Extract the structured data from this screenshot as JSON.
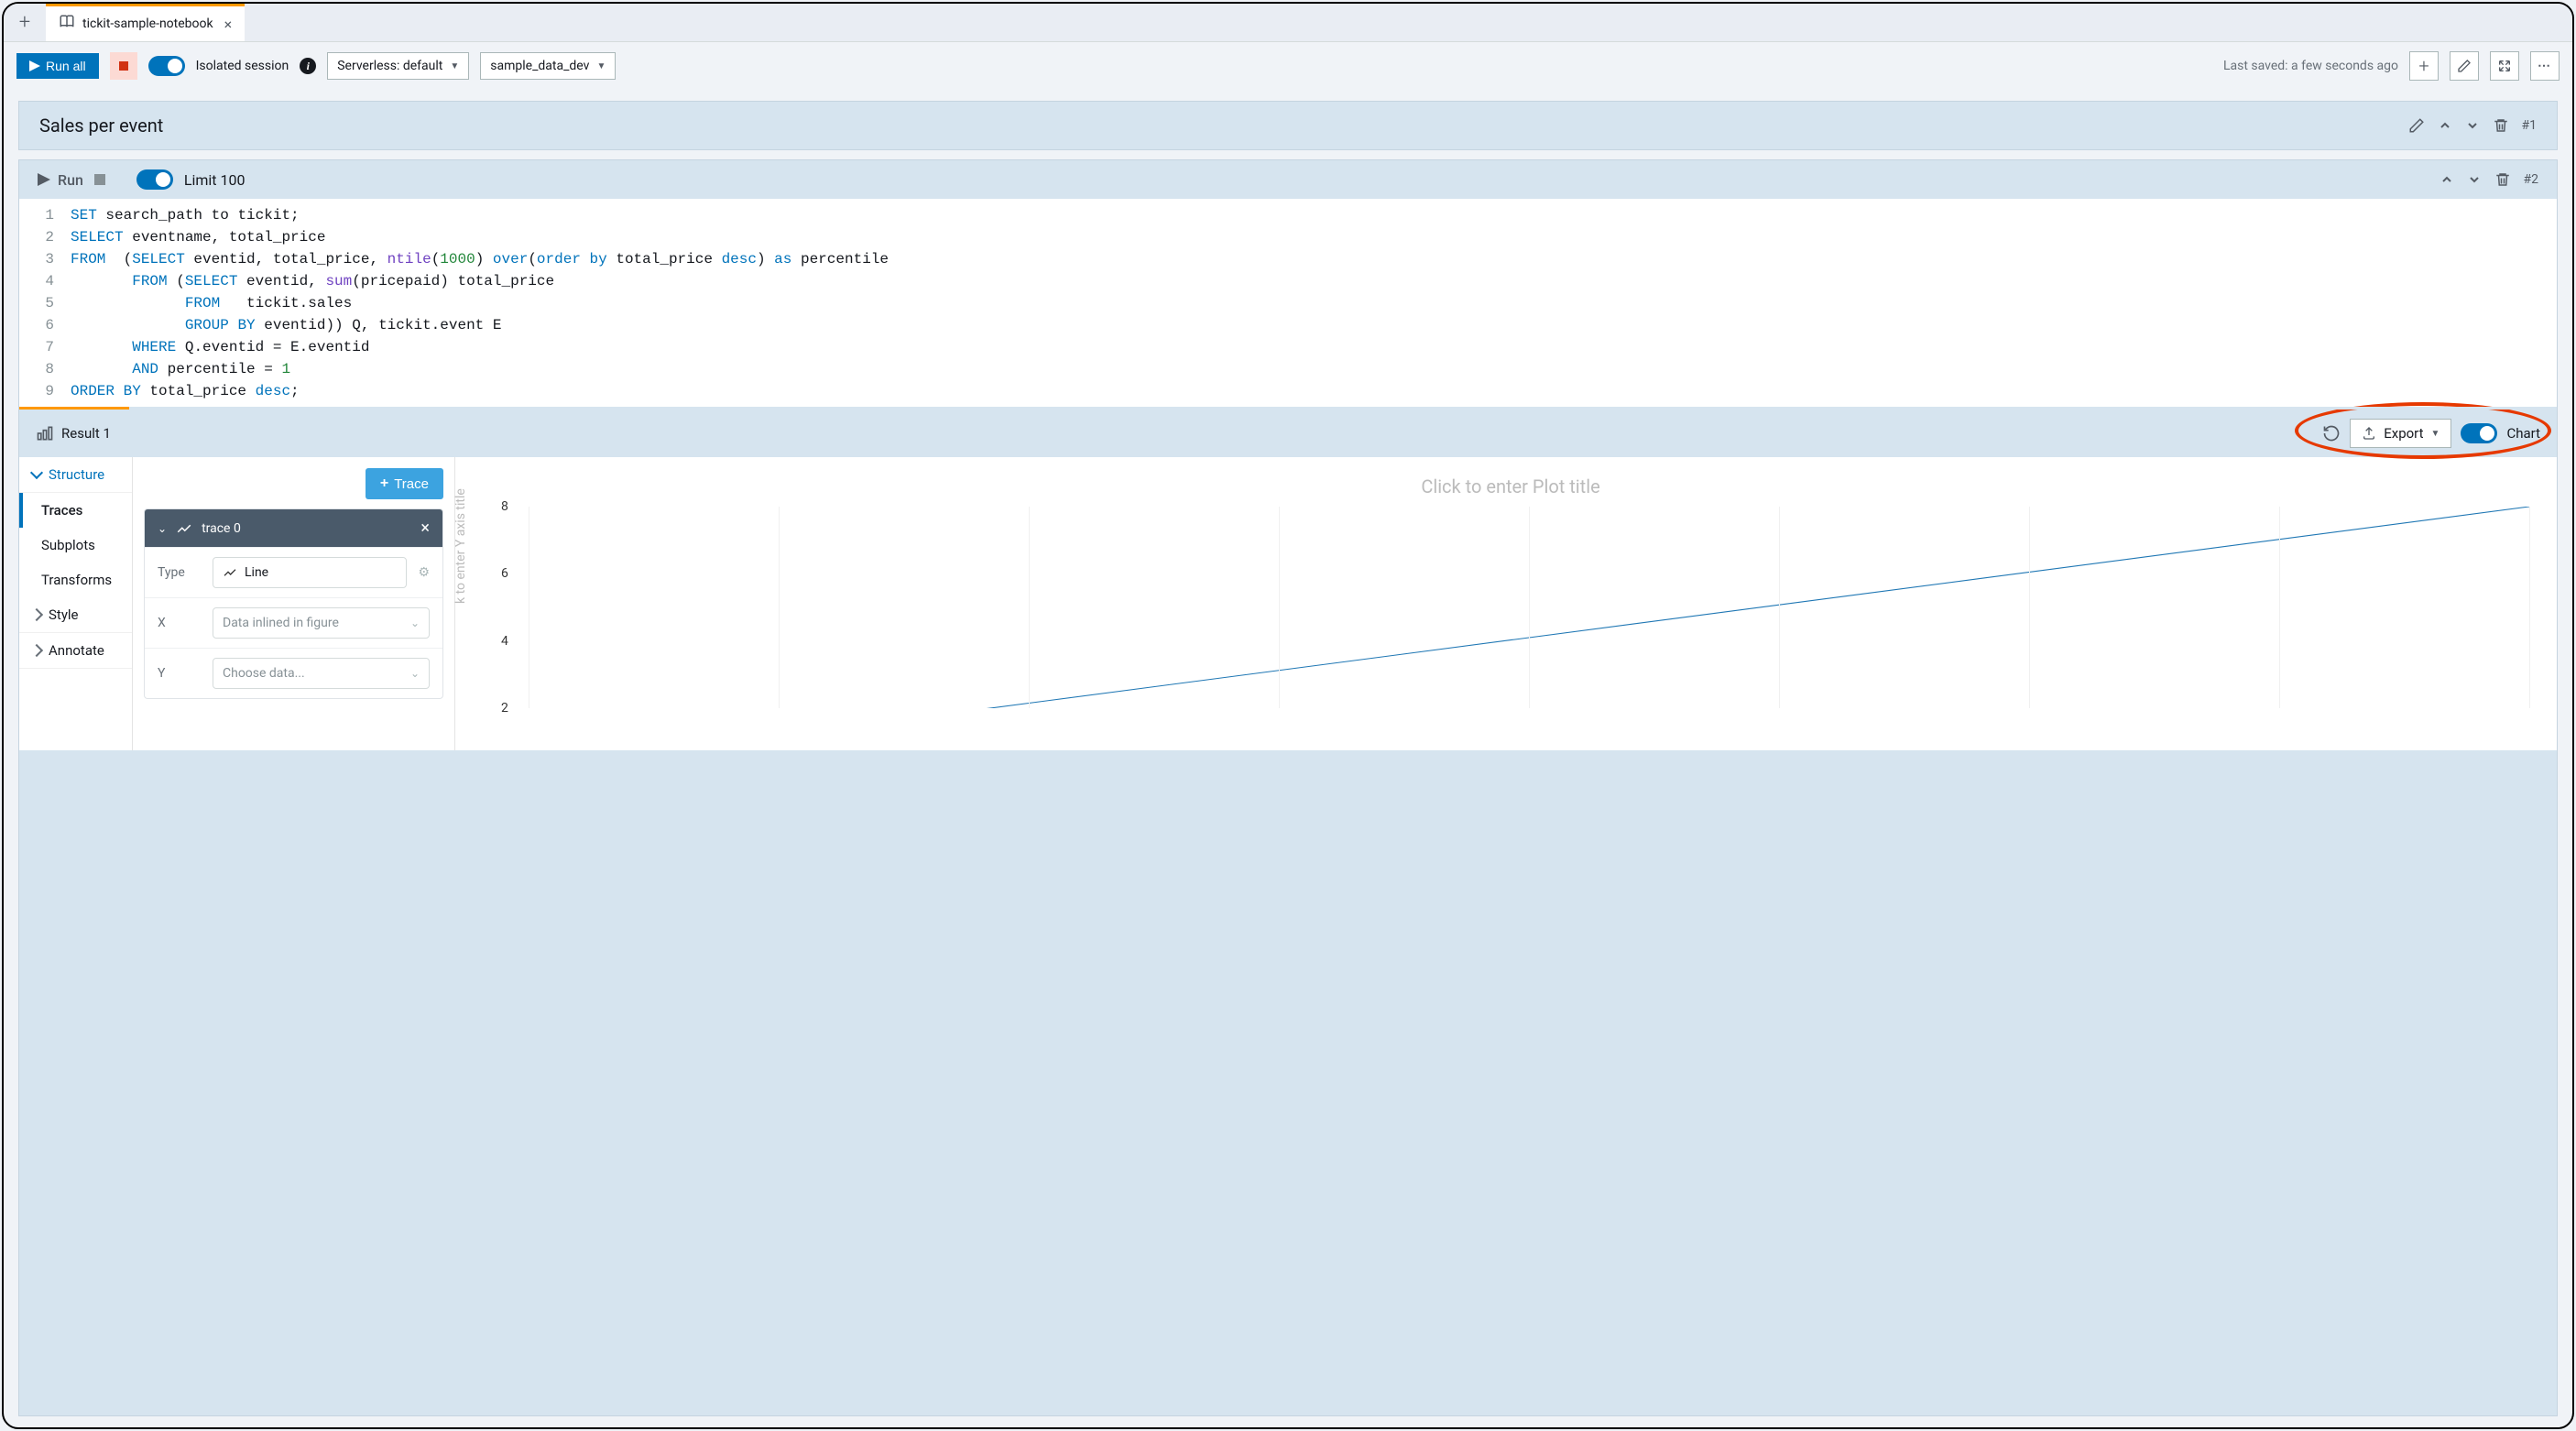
{
  "tab": {
    "title": "tickit-sample-notebook"
  },
  "toolbar": {
    "run_all": "Run all",
    "isolated_label": "Isolated session",
    "connection": "Serverless: default",
    "database": "sample_data_dev",
    "last_saved": "Last saved: a few seconds ago"
  },
  "cell1": {
    "title": "Sales per event",
    "index": "#1"
  },
  "cell2": {
    "run": "Run",
    "limit_label": "Limit 100",
    "index": "#2",
    "code_lines": [
      {
        "n": "1",
        "html": "<span class='kw'>SET</span> search_path to tickit;"
      },
      {
        "n": "2",
        "html": "<span class='kw'>SELECT</span> eventname, total_price"
      },
      {
        "n": "3",
        "html": "<span class='kw'>FROM</span>  (<span class='kw'>SELECT</span> eventid, total_price, <span class='fn'>ntile</span>(<span class='num'>1000</span>) <span class='kw'>over</span>(<span class='kw'>order by</span> total_price <span class='kw'>desc</span>) <span class='kw'>as</span> percentile"
      },
      {
        "n": "4",
        "html": "       <span class='kw'>FROM</span> (<span class='kw'>SELECT</span> eventid, <span class='fn'>sum</span>(pricepaid) total_price"
      },
      {
        "n": "5",
        "html": "             <span class='kw'>FROM</span>   tickit.sales"
      },
      {
        "n": "6",
        "html": "             <span class='kw'>GROUP BY</span> eventid)) Q, tickit.event E"
      },
      {
        "n": "7",
        "html": "       <span class='kw'>WHERE</span> Q.eventid = E.eventid"
      },
      {
        "n": "8",
        "html": "       <span class='kw'>AND</span> percentile = <span class='num'>1</span>"
      },
      {
        "n": "9",
        "html": "<span class='kw'>ORDER BY</span> total_price <span class='kw'>desc</span>;"
      }
    ]
  },
  "result": {
    "tab_label": "Result 1",
    "export": "Export",
    "chart_label": "Chart"
  },
  "builder": {
    "structure": "Structure",
    "traces": "Traces",
    "subplots": "Subplots",
    "transforms": "Transforms",
    "style": "Style",
    "annotate": "Annotate",
    "add_trace": "Trace",
    "trace_name": "trace 0",
    "type_label": "Type",
    "type_value": "Line",
    "x_label": "X",
    "x_placeholder": "Data inlined in figure",
    "y_label": "Y",
    "y_placeholder": "Choose data..."
  },
  "plot": {
    "title_placeholder": "Click to enter Plot title",
    "yaxis_placeholder": "k to enter Y axis title",
    "y_ticks": [
      "8",
      "6",
      "4",
      "2"
    ]
  },
  "chart_data": {
    "type": "line",
    "title": "",
    "x": [
      0,
      1,
      2,
      3,
      4,
      5,
      6,
      7,
      8
    ],
    "y": [
      0,
      1,
      2,
      3,
      4,
      5,
      6,
      7,
      8
    ],
    "ylim": [
      2,
      8
    ],
    "y_ticks": [
      2,
      4,
      6,
      8
    ],
    "xlabel": "",
    "ylabel": ""
  }
}
